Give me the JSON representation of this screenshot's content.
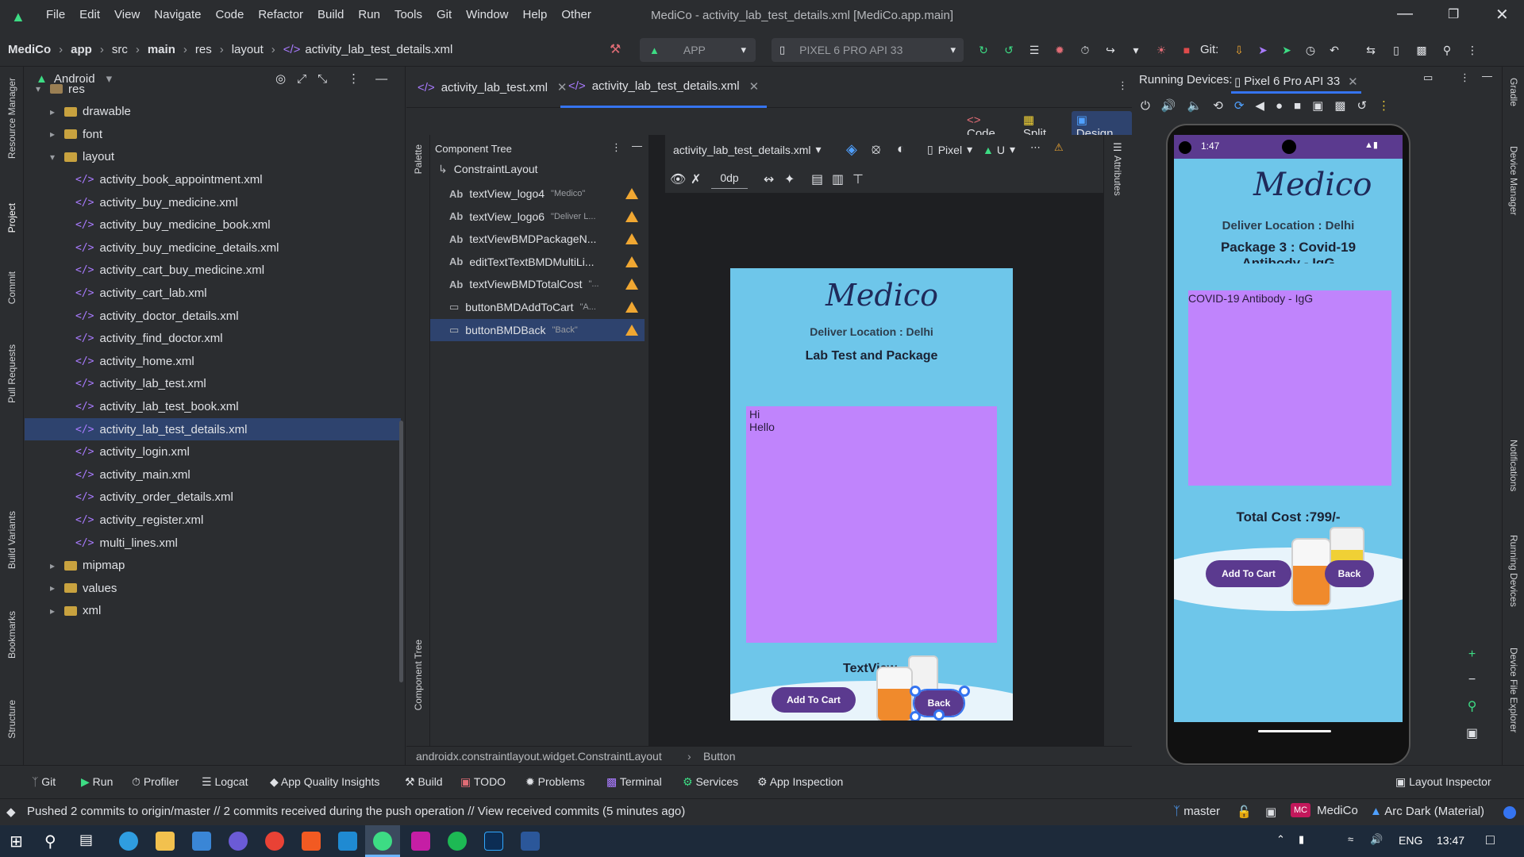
{
  "menu": [
    "File",
    "Edit",
    "View",
    "Navigate",
    "Code",
    "Refactor",
    "Build",
    "Run",
    "Tools",
    "Git",
    "Window",
    "Help",
    "Other"
  ],
  "window_title": "MediCo - activity_lab_test_details.xml [MediCo.app.main]",
  "breadcrumb": [
    "MediCo",
    "app",
    "src",
    "main",
    "res",
    "layout",
    "activity_lab_test_details.xml"
  ],
  "toolbar": {
    "run_config": "APP",
    "device": "PIXEL 6 PRO API 33",
    "git_label": "Git:"
  },
  "project_panel": {
    "view_mode": "Android",
    "tree": [
      {
        "label": "res",
        "type": "folder",
        "expanded": true
      },
      {
        "label": "drawable",
        "type": "folder",
        "expanded": false
      },
      {
        "label": "font",
        "type": "folder",
        "expanded": false
      },
      {
        "label": "layout",
        "type": "folder",
        "expanded": true
      },
      {
        "label": "activity_book_appointment.xml",
        "type": "xml"
      },
      {
        "label": "activity_buy_medicine.xml",
        "type": "xml"
      },
      {
        "label": "activity_buy_medicine_book.xml",
        "type": "xml"
      },
      {
        "label": "activity_buy_medicine_details.xml",
        "type": "xml"
      },
      {
        "label": "activity_cart_buy_medicine.xml",
        "type": "xml"
      },
      {
        "label": "activity_cart_lab.xml",
        "type": "xml"
      },
      {
        "label": "activity_doctor_details.xml",
        "type": "xml"
      },
      {
        "label": "activity_find_doctor.xml",
        "type": "xml"
      },
      {
        "label": "activity_home.xml",
        "type": "xml"
      },
      {
        "label": "activity_lab_test.xml",
        "type": "xml"
      },
      {
        "label": "activity_lab_test_book.xml",
        "type": "xml"
      },
      {
        "label": "activity_lab_test_details.xml",
        "type": "xml",
        "selected": true
      },
      {
        "label": "activity_login.xml",
        "type": "xml"
      },
      {
        "label": "activity_main.xml",
        "type": "xml"
      },
      {
        "label": "activity_order_details.xml",
        "type": "xml"
      },
      {
        "label": "activity_register.xml",
        "type": "xml"
      },
      {
        "label": "multi_lines.xml",
        "type": "xml"
      },
      {
        "label": "mipmap",
        "type": "folder",
        "expanded": false
      },
      {
        "label": "values",
        "type": "folder",
        "expanded": false
      },
      {
        "label": "xml",
        "type": "folder",
        "expanded": false
      }
    ]
  },
  "left_strip": [
    "Resource Manager",
    "Project",
    "Commit",
    "Pull Requests",
    "Build Variants",
    "Bookmarks",
    "Structure"
  ],
  "right_strip": [
    "Gradle",
    "Device Manager",
    "Notifications",
    "Running Devices",
    "Device File Explorer"
  ],
  "editor_tabs": [
    "activity_lab_test.xml",
    "activity_lab_test_details.xml"
  ],
  "view_modes": [
    "Code",
    "Split",
    "Design"
  ],
  "palette_label": "Palette",
  "component_tree": {
    "title": "Component Tree",
    "side_label": "Component Tree",
    "root": "ConstraintLayout",
    "items": [
      {
        "name": "textView_logo4",
        "hint": "\"Medico\"",
        "kind": "Ab"
      },
      {
        "name": "textView_logo6",
        "hint": "\"Deliver L...",
        "kind": "Ab"
      },
      {
        "name": "textViewBMDPackageN...",
        "hint": "",
        "kind": "Ab"
      },
      {
        "name": "editTextTextBMDMultiLi...",
        "hint": "",
        "kind": "Ab"
      },
      {
        "name": "textViewBMDTotalCost",
        "hint": "\"...",
        "kind": "Ab"
      },
      {
        "name": "buttonBMDAddToCart",
        "hint": "\"A...",
        "kind": "btn"
      },
      {
        "name": "buttonBMDBack",
        "hint": "\"Back\"",
        "kind": "btn",
        "selected": true
      }
    ]
  },
  "design_toolbar": {
    "file": "activity_lab_test_details.xml",
    "device": "Pixel",
    "api": "U",
    "margin": "0dp"
  },
  "attributes_label": "Attributes",
  "design_preview": {
    "logo": "Medico",
    "location": "Deliver Location : Delhi",
    "package": "Lab Test and Package",
    "multiline": [
      "Hi",
      "Hello"
    ],
    "total": "TextView",
    "add_btn": "Add To Cart",
    "back_btn": "Back"
  },
  "editor_status": [
    "androidx.constraintlayout.widget.ConstraintLayout",
    "Button"
  ],
  "running_devices": {
    "title": "Running Devices:",
    "device_tab": "Pixel 6 Pro API 33",
    "phone": {
      "time": "1:47",
      "logo": "Medico",
      "location": "Deliver Location : Delhi",
      "package_line1": "Package 3 : Covid-19",
      "package_line2": "Antibody - IgG",
      "multiline": "COVID-19 Antibody - IgG",
      "total": "Total Cost :799/-",
      "add_btn": "Add To Cart",
      "back_btn": "Back"
    }
  },
  "bottom_tools": [
    "Git",
    "Run",
    "Profiler",
    "Logcat",
    "App Quality Insights",
    "Build",
    "TODO",
    "Problems",
    "Terminal",
    "Services",
    "App Inspection",
    "Layout Inspector"
  ],
  "status": {
    "message": "Pushed 2 commits to origin/master // 2 commits received during the push operation // View received commits (5 minutes ago)",
    "branch": "master",
    "project": "MediCo",
    "project_badge": "MC",
    "theme": "Arc Dark (Material)"
  },
  "taskbar": {
    "lang": "ENG",
    "time": "13:47"
  },
  "colors": {
    "accent": "#3574f0",
    "app_blue": "#6ec6ea",
    "app_purple": "#c084fc",
    "button_purple": "#5b3a8f",
    "warning": "#f0a732"
  }
}
